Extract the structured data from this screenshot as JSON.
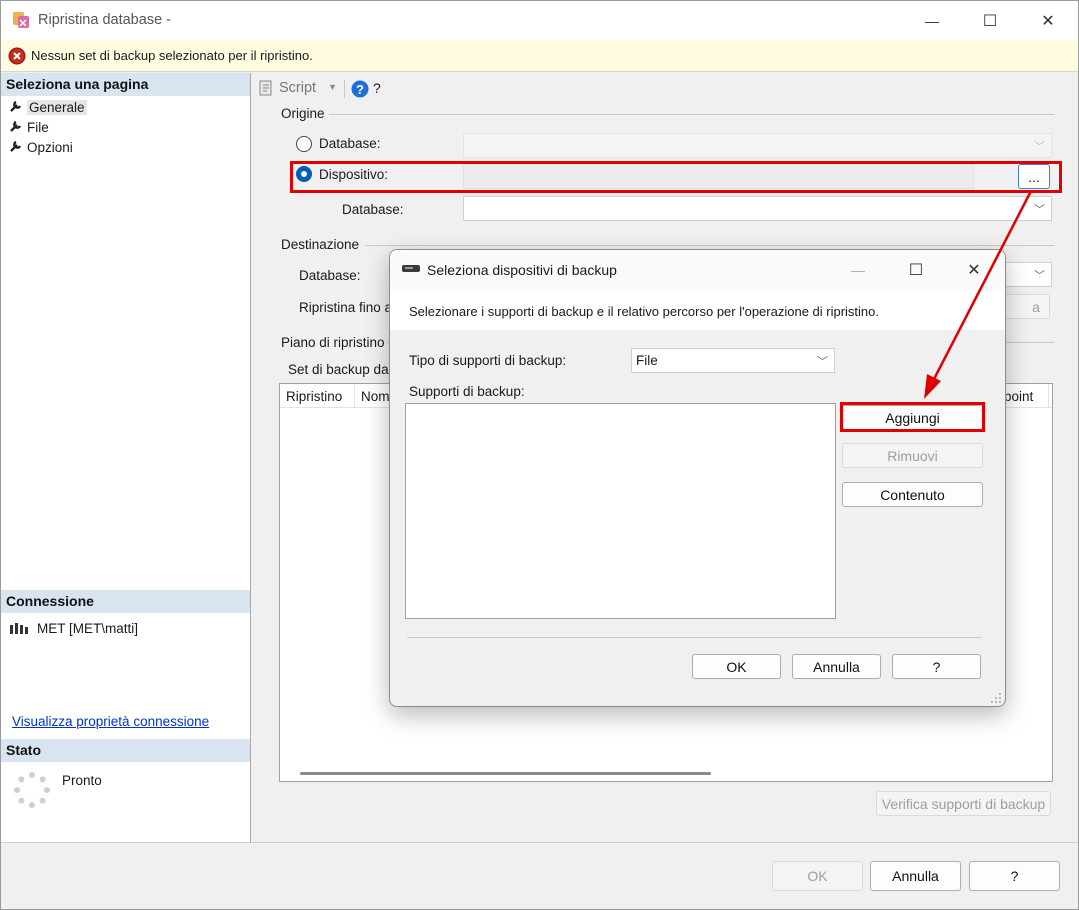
{
  "window": {
    "title": "Ripristina database -",
    "minimize": "—",
    "maximize": "☐",
    "close": "✕"
  },
  "error_bar": {
    "message": "Nessun set di backup selezionato per il ripristino."
  },
  "left_pane": {
    "select_page_header": "Seleziona una pagina",
    "pages": [
      {
        "label": "Generale",
        "selected": true
      },
      {
        "label": "File",
        "selected": false
      },
      {
        "label": "Opzioni",
        "selected": false
      }
    ],
    "connection_header": "Connessione",
    "connection_value": "MET [MET\\matti]",
    "connection_link": "Visualizza proprietà connessione",
    "status_header": "Stato",
    "status_value": "Pronto"
  },
  "toolbar": {
    "script_label": "Script",
    "help_label": "?"
  },
  "source": {
    "group_label": "Origine",
    "database_radio_label": "Database:",
    "device_radio_label": "Dispositivo:",
    "device_browse_button": "...",
    "database_label": "Database:"
  },
  "destination": {
    "group_label": "Destinazione",
    "database_label": "Database:",
    "restore_to_label": "Ripristina fino a",
    "timeline_button_fragment": "a"
  },
  "restore_plan": {
    "group_label": "Piano di ripristino",
    "backup_sets_label": "Set di backup da",
    "columns": [
      "Ripristino",
      "Nome",
      "point"
    ]
  },
  "verify_button": "Verifica supporti di backup",
  "footer": {
    "ok": "OK",
    "cancel": "Annulla",
    "help": "?"
  },
  "dialog": {
    "title": "Seleziona dispositivi di backup",
    "description": "Selezionare i supporti di backup e il relativo percorso per l'operazione di ripristino.",
    "media_type_label": "Tipo di supporti di backup:",
    "media_type_value": "File",
    "media_list_label": "Supporti di backup:",
    "add_button": "Aggiungi",
    "remove_button": "Rimuovi",
    "contents_button": "Contenuto",
    "ok": "OK",
    "cancel": "Annulla",
    "help": "?",
    "minimize": "—",
    "maximize": "☐",
    "close": "✕"
  },
  "colors": {
    "highlight": "#e00000",
    "accent": "#005fb8",
    "link": "#0033cc",
    "error_bar": "#fffce0"
  }
}
